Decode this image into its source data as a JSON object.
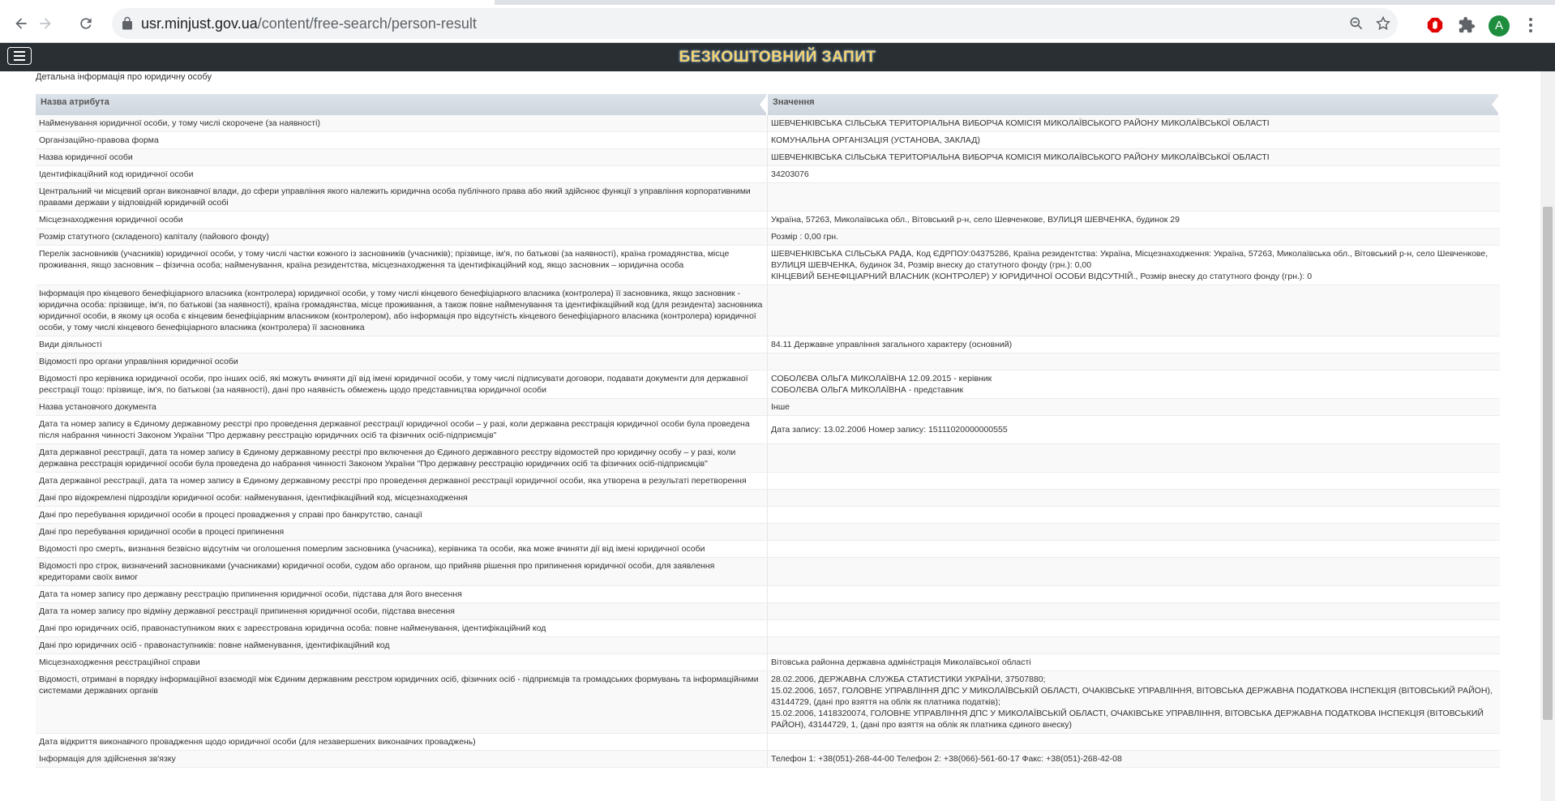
{
  "browser": {
    "url_domain": "usr.minjust.gov.ua",
    "url_path": "/content/free-search/person-result",
    "profile_initial": "A"
  },
  "icons": {
    "back": "back-arrow-icon",
    "forward": "forward-arrow-icon",
    "reload": "reload-icon",
    "lock": "lock-icon",
    "zoom": "zoom-out-icon",
    "bookmark": "star-icon",
    "extension_block": "adblock-icon",
    "extensions": "puzzle-icon",
    "menu": "three-dots-icon",
    "hamburger": "hamburger-icon"
  },
  "colors": {
    "header_bg": "#2a2f33",
    "title": "#f6d36e",
    "table_header": "#d5dbe3"
  },
  "site": {
    "title": "БЕЗКОШТОВНИЙ ЗАПИТ"
  },
  "section": {
    "title": "Детальна інформація про юридичну особу"
  },
  "table": {
    "col_attr": "Назва атрибута",
    "col_value": "Значення",
    "rows": [
      {
        "k": "Найменування юридичної особи, у тому числі скорочене (за наявності)",
        "v": "ШЕВЧЕНКІВСЬКА СІЛЬСЬКА ТЕРИТОРІАЛЬНА ВИБОРЧА КОМІСІЯ МИКОЛАЇВСЬКОГО РАЙОНУ МИКОЛАЇВСЬКОЇ ОБЛАСТІ"
      },
      {
        "k": "Організаційно-правова форма",
        "v": "КОМУНАЛЬНА ОРГАНІЗАЦІЯ (УСТАНОВА, ЗАКЛАД)"
      },
      {
        "k": "Назва юридичної особи",
        "v": "ШЕВЧЕНКІВСЬКА СІЛЬСЬКА ТЕРИТОРІАЛЬНА ВИБОРЧА КОМІСІЯ МИКОЛАЇВСЬКОГО РАЙОНУ МИКОЛАЇВСЬКОЇ ОБЛАСТІ"
      },
      {
        "k": "Ідентифікаційний код юридичної особи",
        "v": "34203076"
      },
      {
        "k": "Центральний чи місцевий орган виконавчої влади, до сфери управління якого належить юридична особа публічного права або який здійснює функції з управління корпоративними правами держави у відповідній юридичній особі",
        "v": ""
      },
      {
        "k": "Місцезнаходження юридичної особи",
        "v": "Україна, 57263, Миколаївська обл., Вітовський р-н, село Шевченкове, ВУЛИЦЯ ШЕВЧЕНКА, будинок 29"
      },
      {
        "k": "Розмір статутного (складеного) капіталу (пайового фонду)",
        "v": "Розмір : 0,00 грн."
      },
      {
        "k": "Перелік засновників (учасників) юридичної особи, у тому числі частки кожного із засновників (учасників); прізвище, ім'я, по батькові (за наявності), країна громадянства, місце проживання, якщо засновник – фізична особа; найменування, країна резидентства, місцезнаходження та ідентифікаційний код, якщо засновник – юридична особа",
        "v": "ШЕВЧЕНКІВСЬКА СІЛЬСЬКА РАДА, Код ЄДРПОУ:04375286, Країна резидентства: Україна, Місцезнаходження: Україна, 57263, Миколаївська обл., Вітовський р-н, село Шевченкове, ВУЛИЦЯ ШЕВЧЕНКА, будинок 34, Розмір внеску до статутного фонду (грн.): 0,00\nКІНЦЕВИЙ БЕНЕФІЦІАРНИЙ ВЛАСНИК (КОНТРОЛЕР) У ЮРИДИЧНОЇ ОСОБИ ВІДСУТНІЙ., Розмір внеску до статутного фонду (грн.): 0"
      },
      {
        "k": "Інформація про кінцевого бенефіціарного власника (контролера) юридичної особи, у тому числі кінцевого бенефіціарного власника (контролера) її засновника, якщо засновник - юридична особа: прізвище, ім'я, по батькові (за наявності), країна громадянства, місце проживання, а також повне найменування та ідентифікаційний код (для резидента) засновника юридичної особи, в якому ця особа є кінцевим бенефіціарним власником (контролером), або інформація про відсутність кінцевого бенефіціарного власника (контролера) юридичної особи, у тому числі кінцевого бенефіціарного власника (контролера) її засновника",
        "v": ""
      },
      {
        "k": "Види діяльності",
        "v": "84.11 Державне управління загального характеру (основний)"
      },
      {
        "k": "Відомості про органи управління юридичної особи",
        "v": ""
      },
      {
        "k": "Відомості про керівника юридичної особи, про інших осіб, які можуть вчиняти дії від імені юридичної особи, у тому числі підписувати договори, подавати документи для державної реєстрації тощо: прізвище, ім'я, по батькові (за наявності), дані про наявність обмежень щодо представництва юридичної особи",
        "v": "СОБОЛЄВА ОЛЬГА МИКОЛАЇВНА 12.09.2015 - керівник\nСОБОЛЄВА ОЛЬГА МИКОЛАЇВНА - представник"
      },
      {
        "k": "Назва установчого документа",
        "v": "Інше"
      },
      {
        "k": "Дата та номер запису в Єдиному державному реєстрі про проведення державної реєстрації юридичної особи – у разі, коли державна реєстрація юридичної особи була проведена після набрання чинності Законом України \"Про державну реєстрацію юридичних осіб та фізичних осіб-підприємців\"",
        "v": "Дата запису: 13.02.2006 Номер запису: 15111020000000555"
      },
      {
        "k": "Дата державної реєстрації, дата та номер запису в Єдиному державному реєстрі про включення до Єдиного державного реєстру відомостей про юридичну особу – у разі, коли державна реєстрація юридичної особи була проведена до набрання чинності Законом України \"Про державну реєстрацію юридичних осіб та фізичних осіб-підприємців\"",
        "v": ""
      },
      {
        "k": "Дата державної реєстрації, дата та номер запису в Єдиному державному реєстрі про проведення державної реєстрації юридичної особи, яка утворена в результаті перетворення",
        "v": ""
      },
      {
        "k": "Дані про відокремлені підрозділи юридичної особи: найменування, ідентифікаційний код, місцезнаходження",
        "v": ""
      },
      {
        "k": "Дані про перебування юридичної особи в процесі провадження у справі про банкрутство, санації",
        "v": ""
      },
      {
        "k": "Дані про перебування юридичної особи в процесі припинення",
        "v": ""
      },
      {
        "k": "Відомості про смерть, визнання безвісно відсутнім чи оголошення померлим засновника (учасника), керівника та особи, яка може вчиняти дії від імені юридичної особи",
        "v": ""
      },
      {
        "k": "Відомості про строк, визначений засновниками (учасниками) юридичної особи, судом або органом, що прийняв рішення про припинення юридичної особи, для заявлення кредиторами своїх вимог",
        "v": ""
      },
      {
        "k": "Дата та номер запису про державну реєстрацію припинення юридичної особи, підстава для його внесення",
        "v": ""
      },
      {
        "k": "Дата та номер запису про відміну державної реєстрації припинення юридичної особи, підстава внесення",
        "v": ""
      },
      {
        "k": "Дані про юридичних осіб, правонаступником яких є зареєстрована юридична особа: повне найменування, ідентифікаційний код",
        "v": ""
      },
      {
        "k": "Дані про юридичних осіб - правонаступників: повне найменування, ідентифікаційний код",
        "v": ""
      },
      {
        "k": "Місцезнаходження реєстраційної справи",
        "v": "Вітовська районна державна адміністрація Миколаївської області"
      },
      {
        "k": "Відомості, отримані в порядку інформаційної взаємодії між Єдиним державним реєстром юридичних осіб, фізичних осіб - підприємців та громадських формувань та інформаційними системами державних органів",
        "v": "28.02.2006, ДЕРЖАВНА СЛУЖБА СТАТИСТИКИ УКРАЇНИ, 37507880;\n15.02.2006, 1657, ГОЛОВНЕ УПРАВЛІННЯ ДПС У МИКОЛАЇВСЬКІЙ ОБЛАСТІ, ОЧАКІВСЬКЕ УПРАВЛІННЯ, ВІТОВСЬКА ДЕРЖАВНА ПОДАТКОВА ІНСПЕКЦІЯ (ВІТОВСЬКИЙ РАЙОН), 43144729, (дані про взяття на облік як платника податків);\n15.02.2006, 1418320074, ГОЛОВНЕ УПРАВЛІННЯ ДПС У МИКОЛАЇВСЬКІЙ ОБЛАСТІ, ОЧАКІВСЬКЕ УПРАВЛІННЯ, ВІТОВСЬКА ДЕРЖАВНА ПОДАТКОВА ІНСПЕКЦІЯ (ВІТОВСЬКИЙ РАЙОН), 43144729, 1, (дані про взяття на облік як платника єдиного внеску)"
      },
      {
        "k": "Дата відкриття виконавчого провадження щодо юридичної особи (для незавершених виконавчих проваджень)",
        "v": ""
      },
      {
        "k": "Інформація для здійснення зв'язку",
        "v": "Телефон 1: +38(051)-268-44-00 Телефон 2: +38(066)-561-60-17 Факс: +38(051)-268-42-08"
      }
    ]
  }
}
